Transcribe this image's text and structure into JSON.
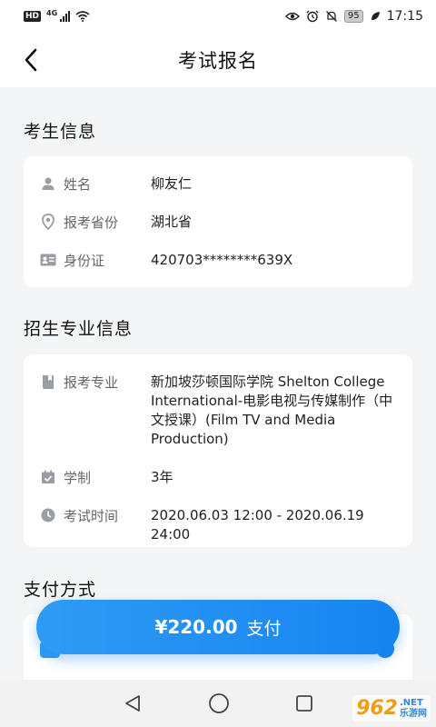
{
  "status_bar": {
    "hd": "HD",
    "network": "4G",
    "battery": "95",
    "time": "17:15"
  },
  "header": {
    "title": "考试报名"
  },
  "candidate_section": {
    "title": "考生信息",
    "rows": [
      {
        "icon": "person-icon",
        "label": "姓名",
        "value": "柳友仁"
      },
      {
        "icon": "location-pin-icon",
        "label": "报考省份",
        "value": "湖北省"
      },
      {
        "icon": "id-card-icon",
        "label": "身份证",
        "value": "420703********639X"
      }
    ]
  },
  "major_section": {
    "title": "招生专业信息",
    "rows": [
      {
        "icon": "book-icon",
        "label": "报考专业",
        "value": "新加坡莎顿国际学院 Shelton College International-电影电视与传媒制作（中文授课）(Film TV and Media Production)"
      },
      {
        "icon": "calendar-icon",
        "label": "学制",
        "value": "3年"
      },
      {
        "icon": "clock-icon",
        "label": "考试时间",
        "value": "2020.06.03 12:00 - 2020.06.19 24:00"
      }
    ]
  },
  "payment_section": {
    "title": "支付方式"
  },
  "pay_button": {
    "amount": "¥220.00",
    "label": "支付"
  },
  "watermark": {
    "number": "962",
    "suffix": ".NET",
    "text": "乐游网"
  },
  "colors": {
    "accent": "#1684f0",
    "background": "#f4f5f7",
    "card": "#ffffff",
    "icon_gray": "#9a9da3"
  }
}
